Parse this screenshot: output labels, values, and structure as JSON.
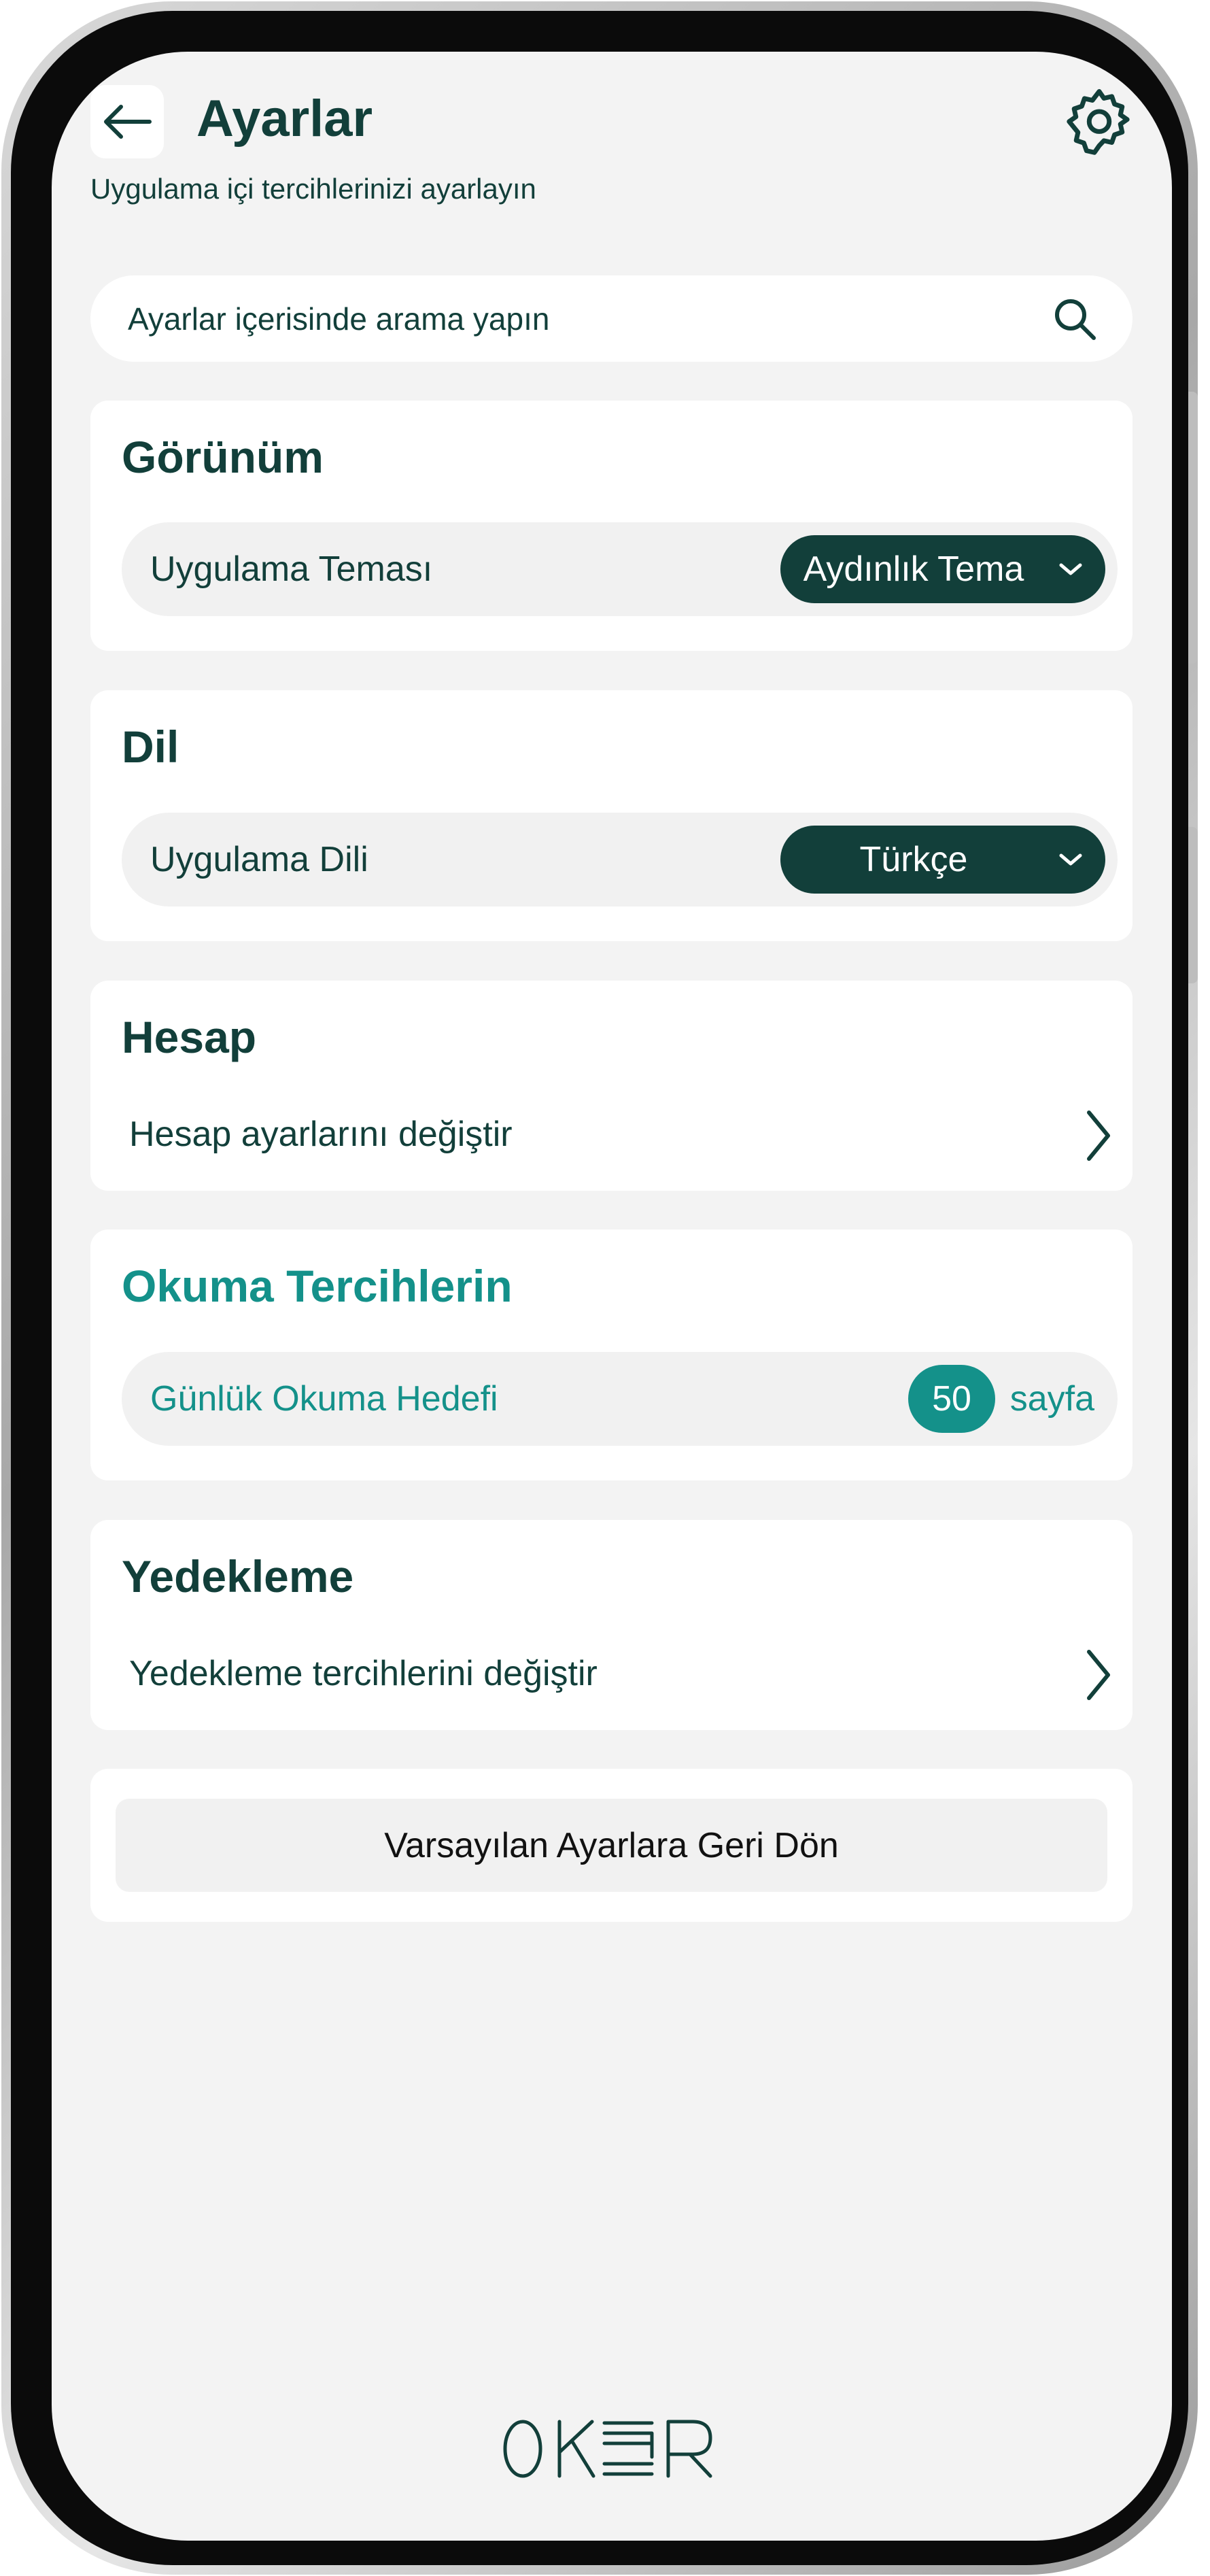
{
  "header": {
    "title": "Ayarlar",
    "subtitle": "Uygulama içi tercihlerinizi ayarlayın"
  },
  "search": {
    "placeholder": "Ayarlar içerisinde arama yapın"
  },
  "sections": {
    "appearance": {
      "title": "Görünüm",
      "row_label": "Uygulama Teması",
      "value": "Aydınlık Tema"
    },
    "language": {
      "title": "Dil",
      "row_label": "Uygulama Dili",
      "value": "Türkçe"
    },
    "account": {
      "title": "Hesap",
      "link_label": "Hesap ayarlarını değiştir"
    },
    "reading": {
      "title": "Okuma Tercihlerin",
      "row_label": "Günlük Okuma Hedefi",
      "goal_value": "50",
      "goal_unit": "sayfa"
    },
    "backup": {
      "title": "Yedekleme",
      "link_label": "Yedekleme tercihlerini değiştir"
    }
  },
  "reset": {
    "label": "Varsayılan Ayarlara Geri Dön"
  },
  "brand": {
    "logo_text": "OKUR"
  },
  "colors": {
    "primary": "#123f3a",
    "accent": "#14918a",
    "background": "#f3f3f3",
    "card": "#ffffff"
  },
  "icons": [
    "arrow-left-icon",
    "gear-icon",
    "search-icon",
    "chevron-down-icon",
    "chevron-right-icon"
  ]
}
